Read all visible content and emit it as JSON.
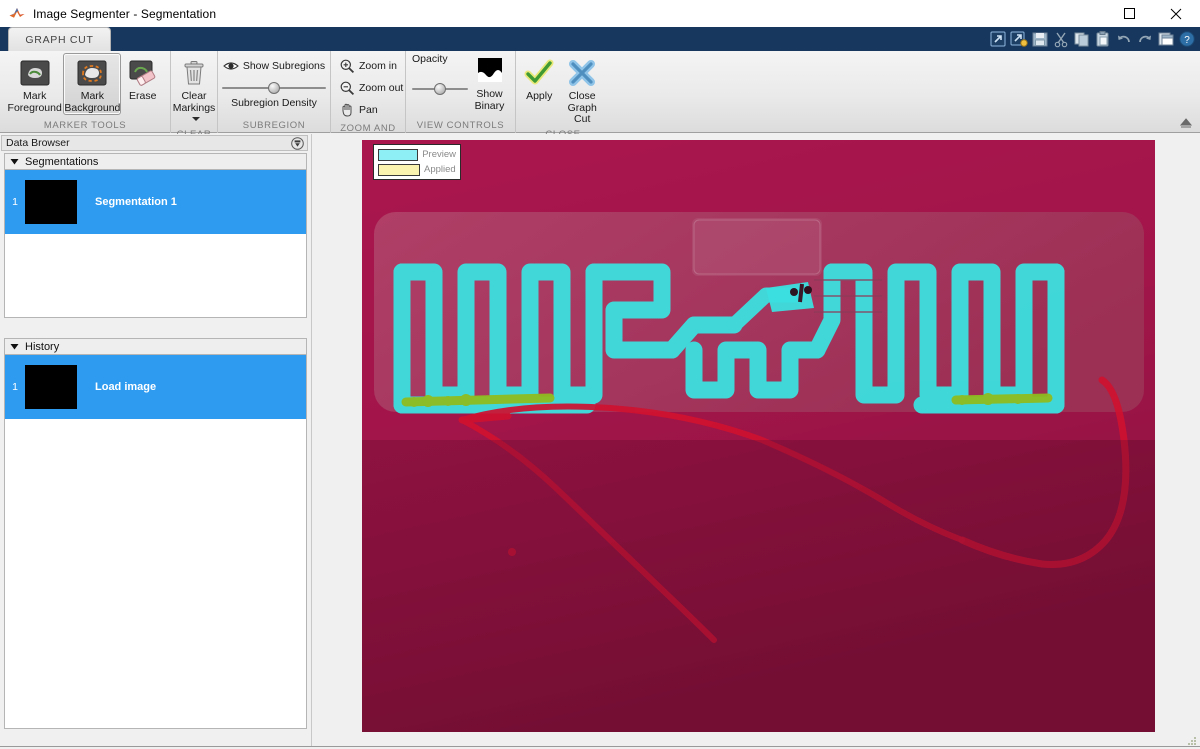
{
  "window": {
    "title": "Image Segmenter - Segmentation",
    "logo_icon": "matlab-logo-icon",
    "maximize_label": "☐",
    "close_label": "✕"
  },
  "quick_access": {
    "icons": [
      {
        "name": "new-segmentation-icon",
        "glyph": "↗"
      },
      {
        "name": "new-segmentation-plus-icon",
        "glyph": "↗"
      },
      {
        "name": "save-icon",
        "glyph": "ὋE"
      },
      {
        "name": "cut-icon",
        "glyph": "✂"
      },
      {
        "name": "copy-icon",
        "glyph": "⧉"
      },
      {
        "name": "paste-icon",
        "glyph": "ὌB"
      },
      {
        "name": "undo-icon",
        "glyph": "↶"
      },
      {
        "name": "redo-icon",
        "glyph": "↷"
      },
      {
        "name": "layout-icon",
        "glyph": "▣"
      },
      {
        "name": "help-icon",
        "glyph": "?"
      }
    ]
  },
  "ribbon": {
    "tab_label": "GRAPH CUT",
    "collapse_icon": "collapse-ribbon-icon",
    "groups": [
      {
        "label": "MARKER TOOLS",
        "buttons": [
          {
            "label_line1": "Mark",
            "label_line2": "Foreground",
            "icon": "mark-foreground-icon",
            "active": false
          },
          {
            "label_line1": "Mark",
            "label_line2": "Background",
            "icon": "mark-background-icon",
            "active": true
          },
          {
            "label_line1": "Erase",
            "label_line2": "",
            "icon": "erase-icon",
            "active": false
          }
        ]
      },
      {
        "label": "CLEAR",
        "buttons": [
          {
            "label_line1": "Clear",
            "label_line2": "Markings",
            "icon": "trash-icon",
            "active": false,
            "has_dropdown": true
          }
        ]
      },
      {
        "label": "SUBREGION SETTINGS",
        "show_subregions_label": "Show Subregions",
        "show_subregions_icon": "eye-icon",
        "slider_label": "Subregion Density",
        "slider_value": 50
      },
      {
        "label": "ZOOM AND PAN",
        "items": [
          {
            "label": "Zoom in",
            "icon": "zoom-in-icon"
          },
          {
            "label": "Zoom out",
            "icon": "zoom-out-icon"
          },
          {
            "label": "Pan",
            "icon": "pan-hand-icon"
          }
        ]
      },
      {
        "label": "VIEW CONTROLS",
        "opacity_label": "Opacity",
        "opacity_value": 50,
        "show_binary_line1": "Show",
        "show_binary_line2": "Binary",
        "show_binary_icon": "show-binary-icon"
      },
      {
        "label": "CLOSE",
        "apply_label": "Apply",
        "apply_icon": "checkmark-icon",
        "close_line1": "Close",
        "close_line2": "Graph Cut",
        "close_icon": "close-x-icon"
      }
    ]
  },
  "data_browser": {
    "title": "Data Browser",
    "dock_icon": "dock-menu-icon",
    "sections": [
      {
        "title": "Segmentations",
        "caret_icon": "caret-down-icon",
        "rows": [
          {
            "number": "1",
            "label": "Segmentation 1",
            "thumbnail": "black-thumbnail",
            "selected": true
          }
        ]
      },
      {
        "title": "History",
        "caret_icon": "caret-down-icon",
        "rows": [
          {
            "number": "1",
            "label": "Load image",
            "thumbnail": "black-thumbnail",
            "selected": true
          }
        ]
      }
    ]
  },
  "image_view": {
    "legend": [
      {
        "label": "Preview",
        "color": "#8ef0f5"
      },
      {
        "label": "Applied",
        "color": "#fbf3b0"
      }
    ],
    "colors": {
      "background_magenta": "#7d1038",
      "substrate": "#a8345f",
      "overlay_cyan": "#3ce0e0",
      "foreground_marker_green": "#8fbc1f",
      "background_marker_red": "#d01030",
      "canvas_border": "#2a2a2a"
    },
    "subject": "rfid-antenna-photo"
  }
}
